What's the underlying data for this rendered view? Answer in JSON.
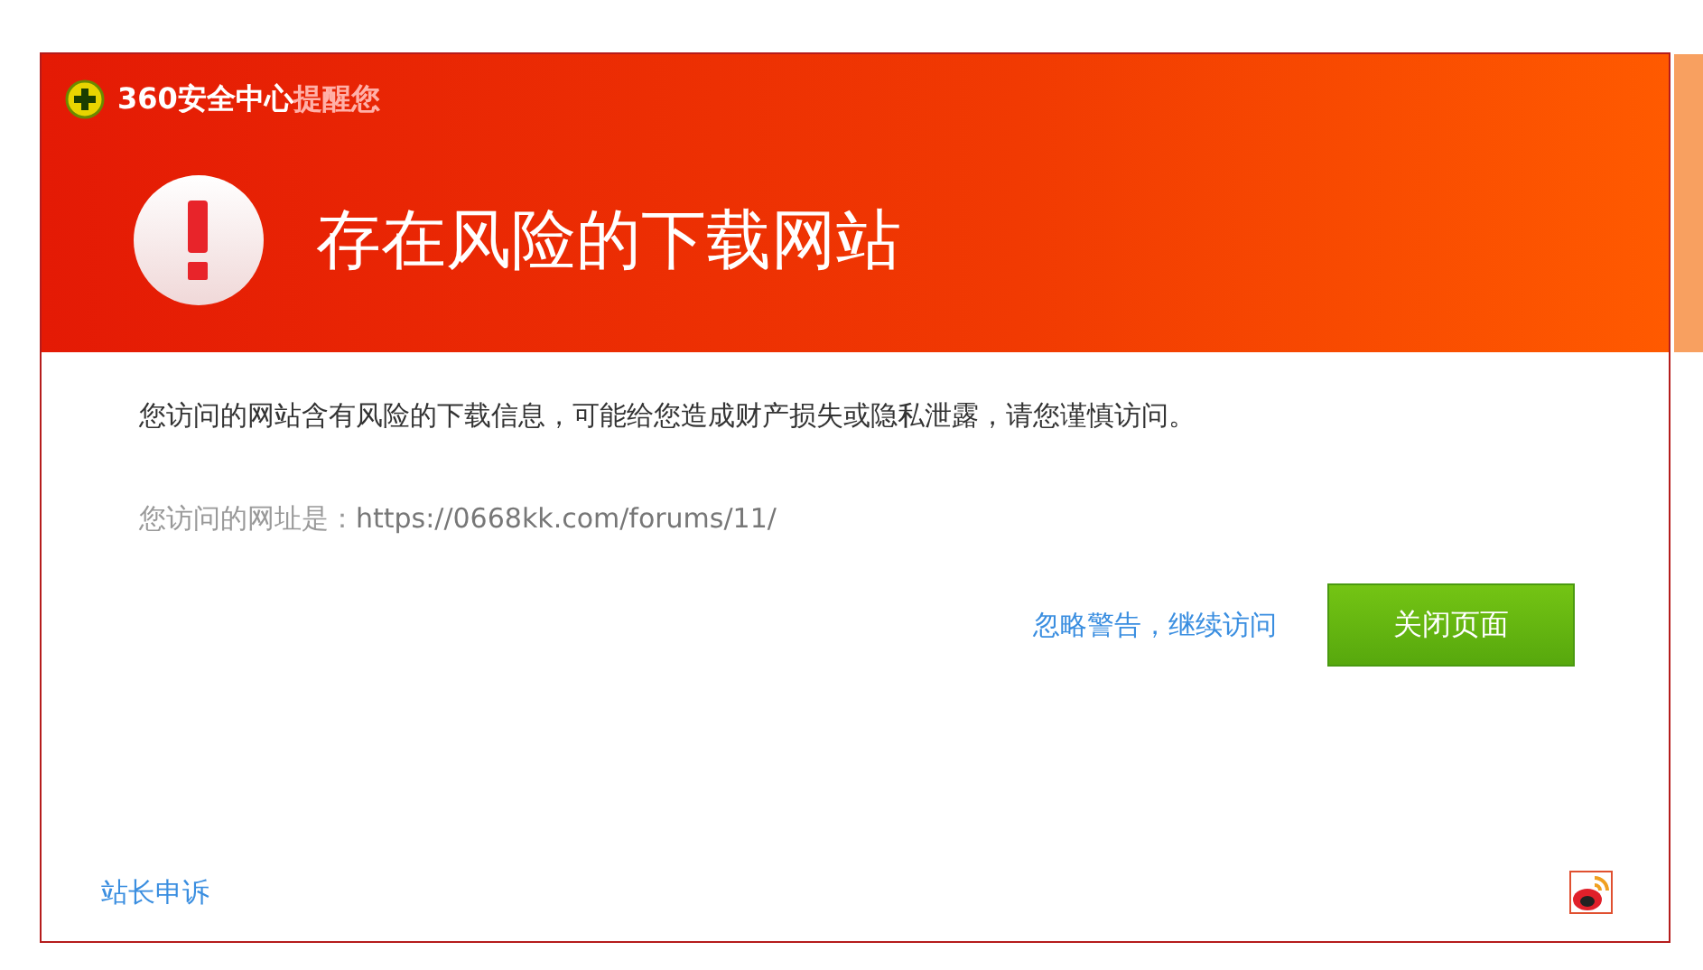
{
  "header": {
    "brand": "360安全中心",
    "tagline": "提醒您",
    "heading": "存在风险的下载网站"
  },
  "message": "您访问的网站含有风险的下载信息，可能给您造成财产损失或隐私泄露，请您谨慎访问。",
  "url_label": "您访问的网址是：",
  "url": "https://0668kk.com/forums/11/",
  "ignore_link": "忽略警告，继续访问",
  "close_button": "关闭页面",
  "footer_link": "站长申诉"
}
